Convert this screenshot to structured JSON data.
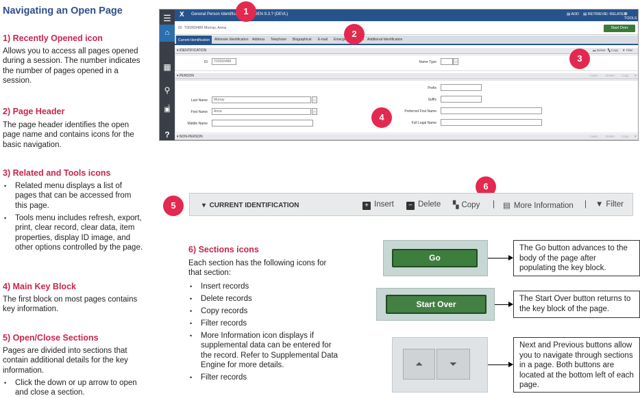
{
  "page_title": "Navigating an Open Page",
  "sections": [
    {
      "heading": "1) Recently Opened icon",
      "text": "Allows you to access all pages opened during a session. The number indicates the number of pages opened in a session."
    },
    {
      "heading": "2) Page Header",
      "text": "The page header identifies the open page name and contains icons for the basic navigation."
    },
    {
      "heading": "3) Related and Tools icons",
      "bullets": [
        "Related menu displays a list of pages that can be accessed from this page.",
        "Tools menu includes refresh, export, print, clear record, clear data, item properties, display ID image, and other options controlled by the page."
      ]
    },
    {
      "heading": "4) Main Key Block",
      "text": "The first block on most pages contains key information."
    },
    {
      "heading": "5) Open/Close Sections",
      "text": "Pages are divided into sections that contain additional details for the key information.",
      "bullets": [
        "Click the down or up arrow to open and close a section."
      ]
    },
    {
      "heading": "6) Sections icons",
      "text": "Each section has the following icons for that section:",
      "bullets": [
        "Insert records",
        "Delete records",
        "Copy records",
        "Filter records",
        "More Information icon displays if supplemental data can be entered for the record. Refer to Supplemental Data Engine for more details.",
        "Filter records"
      ]
    }
  ],
  "screenshot": {
    "close": "X",
    "page_header": "General Person Identification SPAIDEN 9.3.? (DEVL)",
    "header_actions": [
      "ADD",
      "RETRIEVE",
      "RELATED",
      "TOOLS"
    ],
    "key_info": "ID: T00393489   Murray, Anna",
    "start_over": "Start Over",
    "tabs": [
      "Current Identification",
      "Alternate Identification",
      "Address",
      "Telephone",
      "Biographical",
      "E-mail",
      "Emergency Contact",
      "Additional Identification"
    ],
    "sec_identification": "IDENTIFICATION",
    "sec_person": "PERSON",
    "sec_nonperson": "NON-PERSON",
    "sec_icons": [
      "Insert",
      "Delete",
      "Copy",
      "Filter"
    ],
    "id_label": "ID",
    "id_value": "T00393489",
    "name_type_label": "Name Type",
    "last_name_label": "Last Name",
    "last_name_value": "Murray",
    "first_name_label": "First Name",
    "first_name_value": "Anna",
    "middle_name_label": "Middle Name",
    "prefix_label": "Prefix",
    "suffix_label": "Suffix",
    "preferred_label": "Preferred First Name",
    "full_legal_label": "Full Legal Name",
    "recent_count": "2"
  },
  "bubbles": [
    "1",
    "2",
    "3",
    "4",
    "5",
    "6"
  ],
  "section_bar": {
    "title": "CURRENT IDENTIFICATION",
    "insert": "Insert",
    "delete": "Delete",
    "copy": "Copy",
    "more_info": "More Information",
    "filter": "Filter",
    "sep": "|"
  },
  "buttons": {
    "go_label": "Go",
    "go_desc": "The Go button advances to the body of the page after populating the key block.",
    "start_label": "Start Over",
    "start_desc": "The Start Over button returns to the key block of the page.",
    "nav_desc": "Next and Previous buttons allow you to navigate through sections in a page. Both buttons are located at the bottom left of each page."
  },
  "colors": {
    "heading": "#c8254d",
    "title": "#2f4e87",
    "header_bar": "#27538c",
    "bubble": "#e3294f",
    "go_green": "#3d7e3e"
  }
}
